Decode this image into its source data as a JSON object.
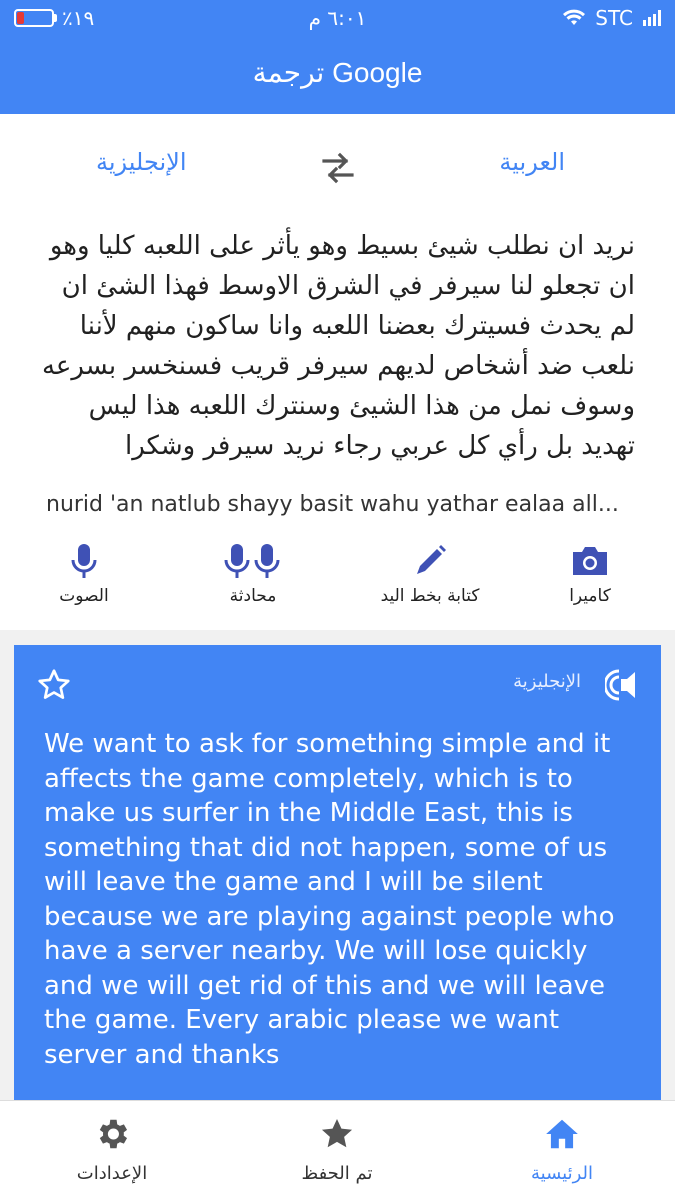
{
  "status": {
    "battery_text": "٪١٩",
    "battery_level": 0.19,
    "time": "٦:٠١ م",
    "carrier": "STC"
  },
  "appbar": {
    "title": "ترجمة Google"
  },
  "languages": {
    "source": "العربية",
    "target": "الإنجليزية",
    "swap_icon": "swap-icon"
  },
  "input": {
    "source_text": "نريد ان نطلب شيئ بسيط وهو يأثر على اللعبه كليا وهو ان تجعلو لنا سيرفر في الشرق الاوسط فهذا الشئ ان لم يحدث فسيترك بعضنا اللعبه وانا ساكون منهم لأننا نلعب ضد أشخاص لديهم سيرفر قريب فسنخسر بسرعه وسوف نمل من هذا الشيئ وسنترك اللعبه هذا ليس تهديد بل رأي كل عربي رجاء نريد سيرفر وشكرا",
    "transliteration": "nurid 'an natlub shayy basit wahu yathar ealaa all..."
  },
  "tools": {
    "voice": "الصوت",
    "conversation": "محادثة",
    "handwriting": "كتابة بخط اليد",
    "camera": "كاميرا"
  },
  "result": {
    "language": "الإنجليزية",
    "text": "We want to ask for something simple and it affects the game completely, which is to make us surfer in the Middle East, this is something that did not happen, some of us will leave the game and I will be silent because we are playing against people who have a server nearby. We will lose quickly and we will get rid of this and we will leave the game. Every arabic please we want server and thanks"
  },
  "nav": {
    "settings": "الإعدادات",
    "saved": "تم الحفظ",
    "home": "الرئيسية"
  },
  "colors": {
    "accent": "#4285f4",
    "battery_low": "#e53935"
  }
}
